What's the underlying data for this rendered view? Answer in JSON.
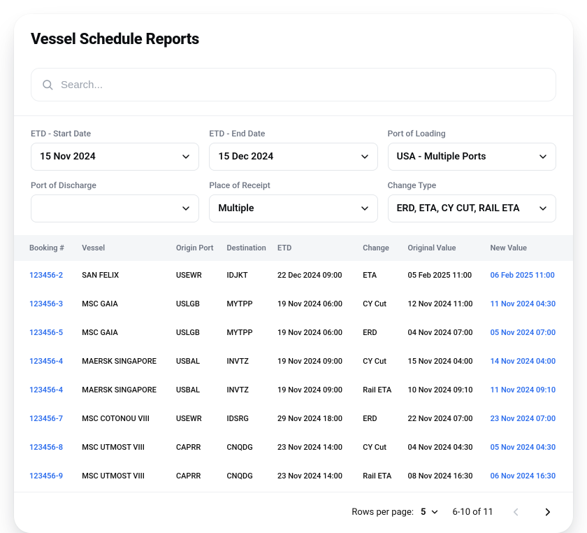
{
  "title": "Vessel Schedule Reports",
  "search": {
    "placeholder": "Search..."
  },
  "filters": {
    "etd_start": {
      "label": "ETD - Start Date",
      "value": "15 Nov 2024"
    },
    "etd_end": {
      "label": "ETD - End Date",
      "value": "15 Dec 2024"
    },
    "port_loading": {
      "label": "Port of Loading",
      "value": "USA - Multiple Ports"
    },
    "port_discharge": {
      "label": "Port of Discharge",
      "value": ""
    },
    "place_receipt": {
      "label": "Place of Receipt",
      "value": "Multiple"
    },
    "change_type": {
      "label": "Change Type",
      "value": "ERD, ETA, CY CUT, RAIL ETA"
    }
  },
  "columns": {
    "booking": "Booking #",
    "vessel": "Vessel",
    "origin": "Origin Port",
    "destination": "Destination",
    "etd": "ETD",
    "change": "Change",
    "original": "Original Value",
    "new": "New Value"
  },
  "rows": [
    {
      "booking": "123456-2",
      "vessel": "SAN FELIX",
      "origin": "USEWR",
      "destination": "IDJKT",
      "etd": "22 Dec 2024 09:00",
      "change": "ETA",
      "original": "05 Feb 2025 11:00",
      "new": "06 Feb 2025 11:00"
    },
    {
      "booking": "123456-3",
      "vessel": "MSC GAIA",
      "origin": "USLGB",
      "destination": "MYTPP",
      "etd": "19 Nov 2024 06:00",
      "change": "CY Cut",
      "original": "12 Nov 2024 11:00",
      "new": "11 Nov 2024 04:30"
    },
    {
      "booking": "123456-5",
      "vessel": "MSC GAIA",
      "origin": "USLGB",
      "destination": "MYTPP",
      "etd": "19 Nov 2024 06:00",
      "change": "ERD",
      "original": "04 Nov 2024 07:00",
      "new": "05 Nov 2024 07:00"
    },
    {
      "booking": "123456-4",
      "vessel": "MAERSK SINGAPORE",
      "origin": "USBAL",
      "destination": "INVTZ",
      "etd": "19 Nov 2024 09:00",
      "change": "CY Cut",
      "original": "15 Nov 2024 04:00",
      "new": "14 Nov 2024 04:00"
    },
    {
      "booking": "123456-4",
      "vessel": "MAERSK SINGAPORE",
      "origin": "USBAL",
      "destination": "INVTZ",
      "etd": "19 Nov 2024 09:00",
      "change": "Rail ETA",
      "original": "10 Nov 2024 09:10",
      "new": "11 Nov 2024 09:10"
    },
    {
      "booking": "123456-7",
      "vessel": "MSC COTONOU VIII",
      "origin": "USEWR",
      "destination": "IDSRG",
      "etd": "29 Nov 2024 18:00",
      "change": "ERD",
      "original": "22 Nov 2024 07:00",
      "new": "23 Nov 2024 07:00"
    },
    {
      "booking": "123456-8",
      "vessel": "MSC UTMOST VIII",
      "origin": "CAPRR",
      "destination": "CNQDG",
      "etd": "23 Nov 2024 14:00",
      "change": "CY Cut",
      "original": "04 Nov 2024 04:30",
      "new": "05 Nov 2024 04:30"
    },
    {
      "booking": "123456-9",
      "vessel": "MSC UTMOST VIII",
      "origin": "CAPRR",
      "destination": "CNQDG",
      "etd": "23 Nov 2024 14:00",
      "change": "Rail ETA",
      "original": "08 Nov 2024 16:30",
      "new": "06 Nov 2024 16:30"
    }
  ],
  "pagination": {
    "rows_label": "Rows per page:",
    "rows_value": "5",
    "range": "6-10 of 11"
  }
}
